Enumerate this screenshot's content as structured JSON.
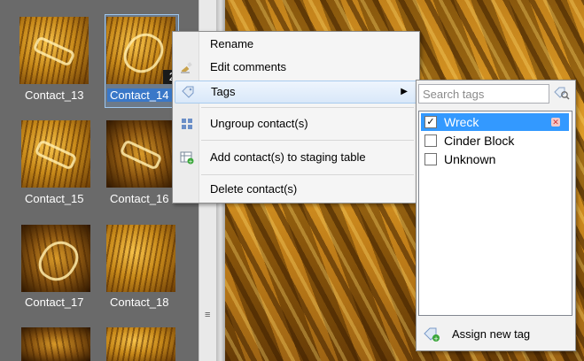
{
  "thumbnails": [
    {
      "label": "Contact_13",
      "selected": false
    },
    {
      "label": "Contact_14",
      "selected": true,
      "badge": "2"
    },
    {
      "label": "Contact_15",
      "selected": false
    },
    {
      "label": "Contact_16",
      "selected": false
    },
    {
      "label": "Contact_17",
      "selected": false
    },
    {
      "label": "Contact_18",
      "selected": false
    }
  ],
  "context_menu": {
    "items": [
      {
        "label": "Rename",
        "icon": "none"
      },
      {
        "label": "Edit comments",
        "icon": "pencil-icon"
      },
      {
        "label": "Tags",
        "icon": "tag-icon",
        "has_submenu": true,
        "highlighted": true
      },
      {
        "label": "Ungroup contact(s)",
        "icon": "ungroup-icon"
      },
      {
        "label": "Add contact(s) to staging table",
        "icon": "table-add-icon"
      },
      {
        "label": "Delete contact(s)",
        "icon": "none"
      }
    ]
  },
  "tag_panel": {
    "search_placeholder": "Search tags",
    "tags": [
      {
        "label": "Wreck",
        "checked": true,
        "selected": true
      },
      {
        "label": "Cinder Block",
        "checked": false,
        "selected": false
      },
      {
        "label": "Unknown",
        "checked": false,
        "selected": false
      }
    ],
    "assign_label": "Assign new tag"
  },
  "colors": {
    "selection": "#3399ff",
    "panel_bg": "#6a6a6a",
    "sonar": "#d9951f"
  }
}
